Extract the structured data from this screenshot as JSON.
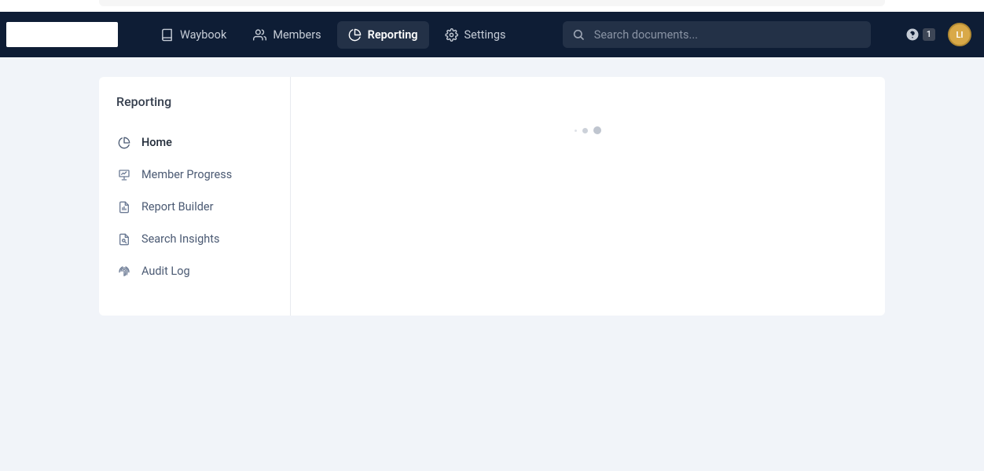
{
  "nav": {
    "waybook": "Waybook",
    "members": "Members",
    "reporting": "Reporting",
    "settings": "Settings"
  },
  "search": {
    "placeholder": "Search documents..."
  },
  "help": {
    "badge": "1"
  },
  "avatar": {
    "initials": "LI"
  },
  "sidebar": {
    "title": "Reporting",
    "items": [
      {
        "label": "Home"
      },
      {
        "label": "Member Progress"
      },
      {
        "label": "Report Builder"
      },
      {
        "label": "Search Insights"
      },
      {
        "label": "Audit Log"
      }
    ]
  }
}
